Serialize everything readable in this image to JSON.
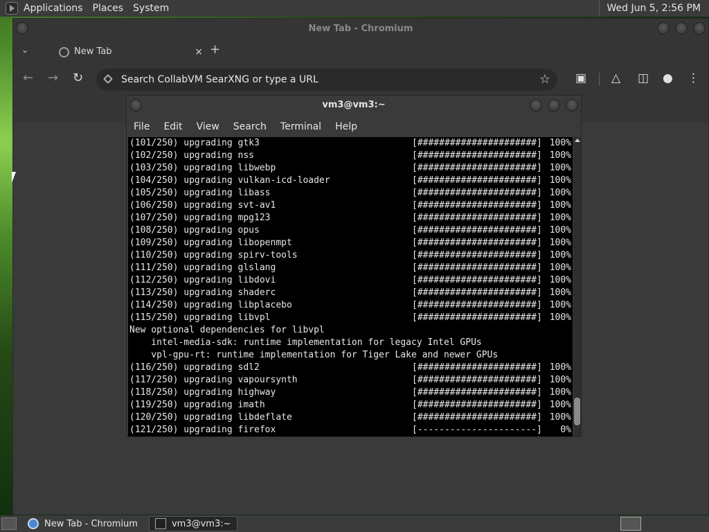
{
  "top_panel": {
    "menus": [
      "Applications",
      "Places",
      "System"
    ],
    "clock": "Wed Jun  5, 2:56 PM"
  },
  "chromium": {
    "window_title": "New Tab - Chromium",
    "tab_label": "New Tab",
    "tab_close": "×",
    "new_tab": "+",
    "omnibox_placeholder": "Search CollabVM SearXNG or type a URL",
    "icons": [
      "back-icon",
      "forward-icon",
      "reload-icon",
      "star-icon",
      "extensions-icon",
      "labs-icon",
      "side-panel-icon",
      "profile-icon",
      "menu-icon"
    ]
  },
  "terminal": {
    "window_title": "vm3@vm3:~",
    "menus": [
      "File",
      "Edit",
      "View",
      "Search",
      "Terminal",
      "Help"
    ],
    "lines": [
      {
        "text": "(101/250) upgrading gtk3",
        "bar": "[######################]",
        "pct": "100%"
      },
      {
        "text": "(102/250) upgrading nss",
        "bar": "[######################]",
        "pct": "100%"
      },
      {
        "text": "(103/250) upgrading libwebp",
        "bar": "[######################]",
        "pct": "100%"
      },
      {
        "text": "(104/250) upgrading vulkan-icd-loader",
        "bar": "[######################]",
        "pct": "100%"
      },
      {
        "text": "(105/250) upgrading libass",
        "bar": "[######################]",
        "pct": "100%"
      },
      {
        "text": "(106/250) upgrading svt-av1",
        "bar": "[######################]",
        "pct": "100%"
      },
      {
        "text": "(107/250) upgrading mpg123",
        "bar": "[######################]",
        "pct": "100%"
      },
      {
        "text": "(108/250) upgrading opus",
        "bar": "[######################]",
        "pct": "100%"
      },
      {
        "text": "(109/250) upgrading libopenmpt",
        "bar": "[######################]",
        "pct": "100%"
      },
      {
        "text": "(110/250) upgrading spirv-tools",
        "bar": "[######################]",
        "pct": "100%"
      },
      {
        "text": "(111/250) upgrading glslang",
        "bar": "[######################]",
        "pct": "100%"
      },
      {
        "text": "(112/250) upgrading libdovi",
        "bar": "[######################]",
        "pct": "100%"
      },
      {
        "text": "(113/250) upgrading shaderc",
        "bar": "[######################]",
        "pct": "100%"
      },
      {
        "text": "(114/250) upgrading libplacebo",
        "bar": "[######################]",
        "pct": "100%"
      },
      {
        "text": "(115/250) upgrading libvpl",
        "bar": "[######################]",
        "pct": "100%"
      },
      {
        "text": "New optional dependencies for libvpl",
        "bar": "",
        "pct": ""
      },
      {
        "text": "    intel-media-sdk: runtime implementation for legacy Intel GPUs",
        "bar": "",
        "pct": ""
      },
      {
        "text": "    vpl-gpu-rt: runtime implementation for Tiger Lake and newer GPUs",
        "bar": "",
        "pct": ""
      },
      {
        "text": "(116/250) upgrading sdl2",
        "bar": "[######################]",
        "pct": "100%"
      },
      {
        "text": "(117/250) upgrading vapoursynth",
        "bar": "[######################]",
        "pct": "100%"
      },
      {
        "text": "(118/250) upgrading highway",
        "bar": "[######################]",
        "pct": "100%"
      },
      {
        "text": "(119/250) upgrading imath",
        "bar": "[######################]",
        "pct": "100%"
      },
      {
        "text": "(120/250) upgrading libdeflate",
        "bar": "[######################]",
        "pct": "100%"
      },
      {
        "text": "(121/250) upgrading firefox",
        "bar": "[----------------------]",
        "pct": "0%"
      }
    ]
  },
  "taskbar": {
    "tasks": [
      {
        "label": "New Tab - Chromium",
        "active": false
      },
      {
        "label": "vm3@vm3:~",
        "active": true
      }
    ]
  }
}
